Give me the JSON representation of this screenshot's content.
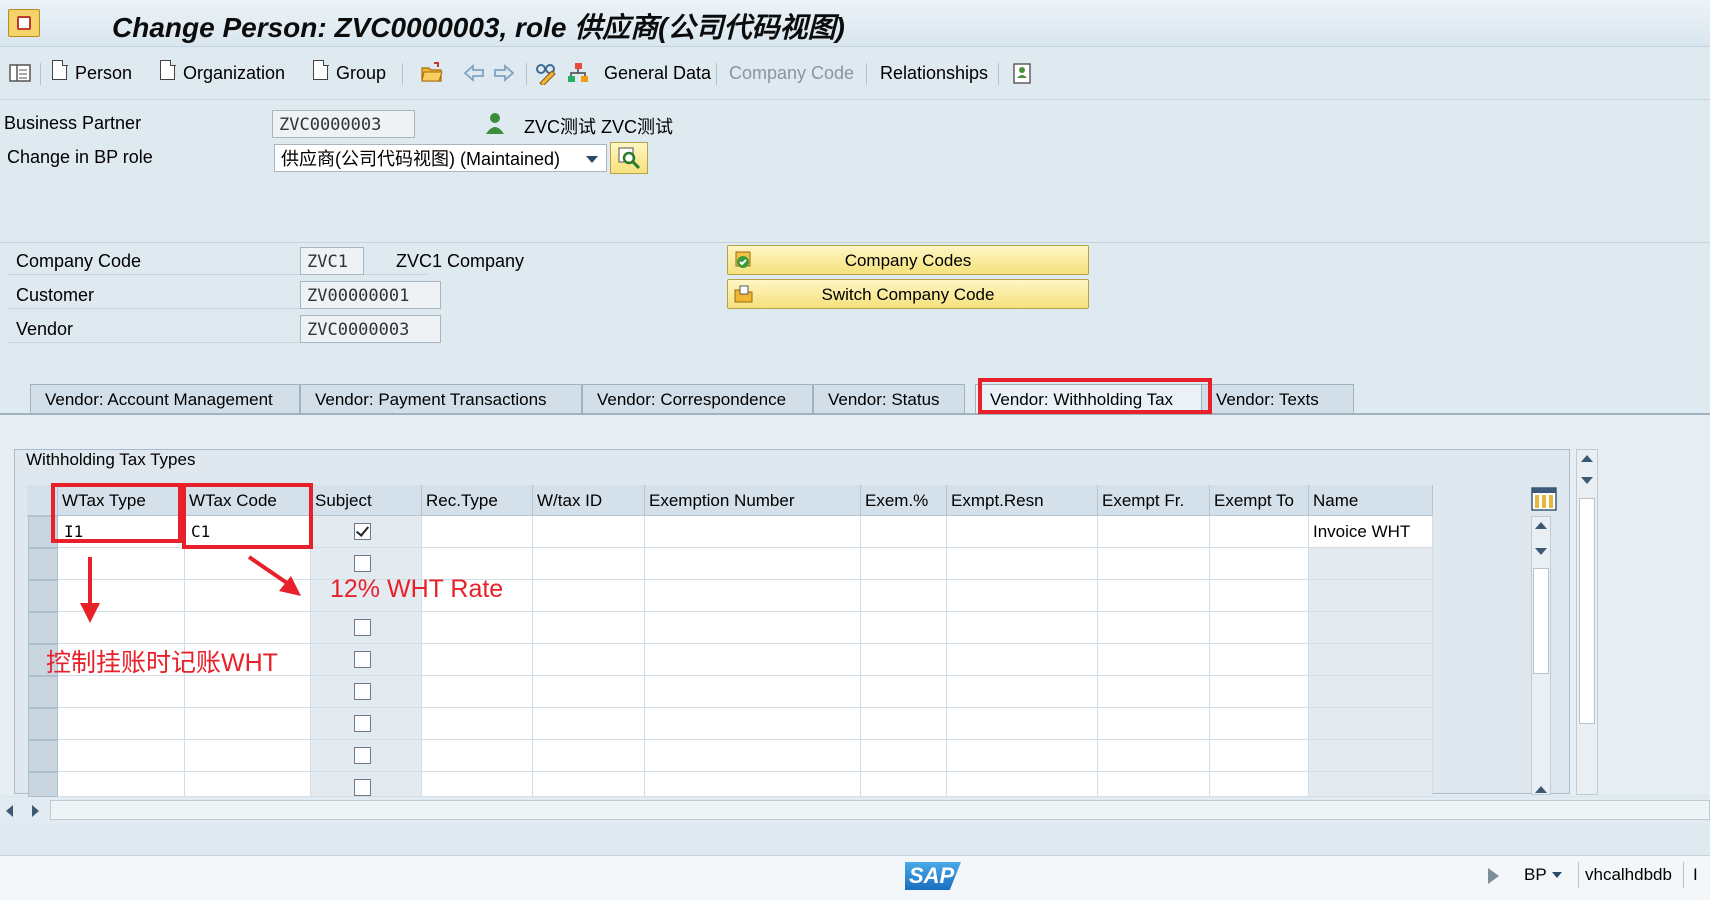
{
  "window": {
    "title": "Change Person: ZVC0000003, role 供应商(公司代码视图)"
  },
  "toolbar": {
    "person": "Person",
    "organization": "Organization",
    "group": "Group",
    "general_data": "General Data",
    "company_code": "Company Code",
    "relationships": "Relationships"
  },
  "header": {
    "bp_label": "Business Partner",
    "bp_value": "ZVC0000003",
    "bp_name": "ZVC测试 ZVC测试",
    "role_label": "Change in BP role",
    "role_value": "供应商(公司代码视图) (Maintained)"
  },
  "company": {
    "company_code_label": "Company Code",
    "company_code_value": "ZVC1",
    "company_name": "ZVC1 Company",
    "customer_label": "Customer",
    "customer_value": "ZV00000001",
    "vendor_label": "Vendor",
    "vendor_value": "ZVC0000003",
    "company_codes_button": "Company Codes",
    "switch_button": "Switch Company Code"
  },
  "tabs": [
    {
      "label": "Vendor: Account Management"
    },
    {
      "label": "Vendor: Payment Transactions"
    },
    {
      "label": "Vendor: Correspondence"
    },
    {
      "label": "Vendor: Status"
    },
    {
      "label": "Vendor: Withholding Tax",
      "active": true
    },
    {
      "label": "Vendor: Texts"
    }
  ],
  "withholding": {
    "group_title": "Withholding Tax Types",
    "columns": [
      "WTax Type",
      "WTax Code",
      "Subject",
      "Rec.Type",
      "W/tax ID",
      "Exemption Number",
      "Exem.%",
      "Exmpt.Resn",
      "Exempt Fr.",
      "Exempt To",
      "Name"
    ],
    "rows": [
      {
        "wtax_type": "I1",
        "wtax_code": "C1",
        "subject": true,
        "name": "Invoice WHT"
      },
      {
        "wtax_type": "",
        "wtax_code": "",
        "subject": false,
        "name": ""
      },
      {
        "wtax_type": "",
        "wtax_code": "",
        "subject": null,
        "name": ""
      },
      {
        "wtax_type": "",
        "wtax_code": "",
        "subject": false,
        "name": ""
      },
      {
        "wtax_type": "",
        "wtax_code": "",
        "subject": false,
        "name": ""
      },
      {
        "wtax_type": "",
        "wtax_code": "",
        "subject": false,
        "name": ""
      },
      {
        "wtax_type": "",
        "wtax_code": "",
        "subject": false,
        "name": ""
      },
      {
        "wtax_type": "",
        "wtax_code": "",
        "subject": false,
        "name": ""
      },
      {
        "wtax_type": "",
        "wtax_code": "",
        "subject": false,
        "name": ""
      }
    ]
  },
  "annotations": {
    "wht_rate": "12% WHT Rate",
    "control_note": "控制挂账时记账WHT",
    "color": "#e8202a"
  },
  "statusbar": {
    "transaction": "BP",
    "server": "vhcalhdbdb",
    "trailing": "I"
  },
  "colors": {
    "background": "#dfe9f0",
    "button_yellow": "#f5e17c",
    "annotation_red": "#e8202a"
  }
}
